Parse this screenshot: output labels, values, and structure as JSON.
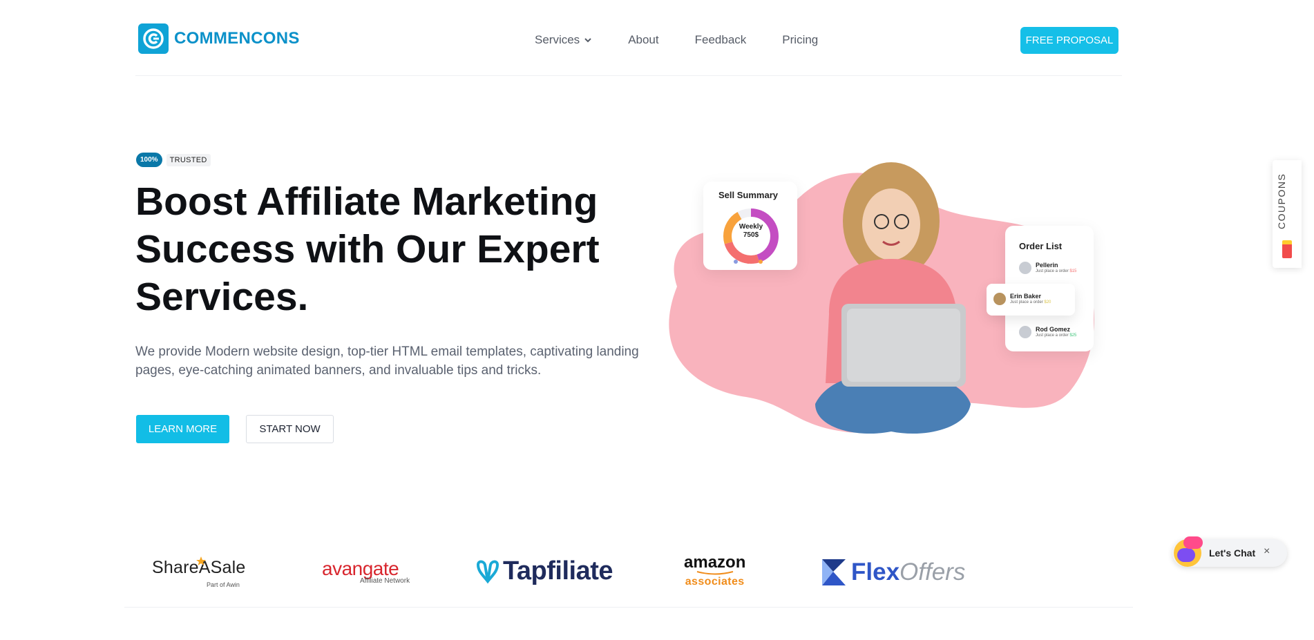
{
  "brand": {
    "name": "COMMENCONS",
    "color": "#0b91c9"
  },
  "nav": {
    "items": [
      {
        "label": "Services",
        "has_dropdown": true
      },
      {
        "label": "About"
      },
      {
        "label": "Feedback"
      },
      {
        "label": "Pricing"
      }
    ],
    "cta": "FREE PROPOSAL"
  },
  "hero": {
    "badge_pill": "100%",
    "badge_text": "TRUSTED",
    "title_lines": [
      "Boost Affiliate Marketing",
      "Success with Our Expert",
      "Services."
    ],
    "description": "We provide Modern website design, top-tier HTML email templates, captivating landing pages, eye-catching animated banners, and invaluable tips and tricks.",
    "btn_primary": "LEARN MORE",
    "btn_secondary": "START NOW"
  },
  "illustration": {
    "sell_summary": {
      "title": "Sell Summary",
      "label_line1": "Weekly",
      "label_line2": "750$"
    },
    "order_list": {
      "title": "Order List",
      "orders": [
        {
          "name": "Pellerin",
          "sub": "Just place a order",
          "amount": "$15"
        },
        {
          "name": "Erin Baker",
          "sub": "Just place a order",
          "amount": "$20"
        },
        {
          "name": "Rod Gomez",
          "sub": "Just place a order",
          "amount": "$25"
        }
      ]
    }
  },
  "side_tab": {
    "label": "COUPONS"
  },
  "partners": {
    "shareasale": "ShareASale",
    "shareasale_sub": "Part of Awin",
    "avangate": "avangate",
    "avangate_sub": "Affiliate Network",
    "tapfiliate": "Tapfiliate",
    "amazon_top": "amazon",
    "amazon_bottom": "associates",
    "flex": "Flex",
    "offers": "Offers"
  },
  "chat": {
    "label": "Let's Chat",
    "close": "×"
  },
  "colors": {
    "accent": "#15bfe8",
    "blob": "#f9b3bd",
    "badge": "#0a78a8"
  }
}
